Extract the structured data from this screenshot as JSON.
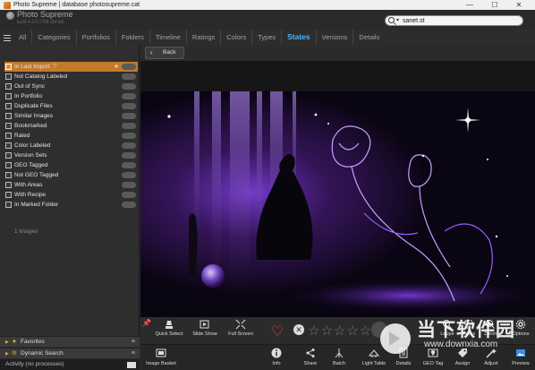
{
  "window": {
    "title": "Photo Supreme | database photosupreme.cat",
    "controls": {
      "minimize": "—",
      "maximize": "☐",
      "close": "✕"
    }
  },
  "header": {
    "app_name": "Photo Supreme",
    "version": "build 4.3.2.1758 (64-bit)",
    "search_value": "sanet.st",
    "search_caret": "▾"
  },
  "nav": {
    "tabs": [
      {
        "label": "All",
        "active": false
      },
      {
        "label": "Categories",
        "active": false
      },
      {
        "label": "Portfolios",
        "active": false
      },
      {
        "label": "Folders",
        "active": false
      },
      {
        "label": "Timeline",
        "active": false
      },
      {
        "label": "Ratings",
        "active": false
      },
      {
        "label": "Colors",
        "active": false
      },
      {
        "label": "Types",
        "active": false
      },
      {
        "label": "States",
        "active": true
      },
      {
        "label": "Versions",
        "active": false
      },
      {
        "label": "Details",
        "active": false
      }
    ]
  },
  "sidebar": {
    "states": [
      {
        "label": "In Last Import",
        "selected": true
      },
      {
        "label": "Not Catalog Labeled"
      },
      {
        "label": "Out of Sync"
      },
      {
        "label": "In Portfolio"
      },
      {
        "label": "Duplicate Files"
      },
      {
        "label": "Similar Images"
      },
      {
        "label": "Bookmarked"
      },
      {
        "label": "Rated"
      },
      {
        "label": "Color Labeled"
      },
      {
        "label": "Version Sets"
      },
      {
        "label": "GEO Tagged"
      },
      {
        "label": "Not GEO Tagged"
      },
      {
        "label": "With Areas"
      },
      {
        "label": "With Recipe"
      },
      {
        "label": "In Marked Folder"
      }
    ],
    "image_count": "1 images",
    "favorites_label": "Favorites",
    "dynamic_search_label": "Dynamic Search",
    "activity_label": "Activity (no processes)"
  },
  "main": {
    "back_label": "Back",
    "toolbar_top": [
      {
        "label": "Quick Select",
        "icon": "quick-select-icon"
      },
      {
        "label": "Slide Show",
        "icon": "slide-show-icon"
      },
      {
        "label": "Full Screen",
        "icon": "full-screen-icon"
      }
    ],
    "toolbar_top_right": [
      {
        "label": "Loupe",
        "icon": "loupe-icon"
      },
      {
        "label": "Areas",
        "icon": "areas-icon"
      },
      {
        "label": "Zoom",
        "icon": "zoom-icon"
      },
      {
        "label": "Options",
        "icon": "options-icon"
      }
    ],
    "toolbar_bottom": [
      {
        "label": "Image Basket",
        "icon": "image-basket-icon"
      },
      {
        "label": "Info",
        "icon": "info-icon"
      },
      {
        "label": "Share",
        "icon": "share-icon"
      },
      {
        "label": "Batch",
        "icon": "batch-icon"
      },
      {
        "label": "Light Table",
        "icon": "light-table-icon"
      },
      {
        "label": "Details",
        "icon": "details-icon"
      },
      {
        "label": "GEO Tag",
        "icon": "geo-tag-icon"
      },
      {
        "label": "Assign",
        "icon": "assign-icon"
      },
      {
        "label": "Adjust",
        "icon": "adjust-icon"
      },
      {
        "label": "Preview",
        "icon": "preview-icon"
      }
    ]
  },
  "watermark": {
    "text": "当下软件园",
    "url": "www.downxia.com"
  },
  "colors": {
    "accent": "#4fb4ff",
    "selected_row": "#c47a2b",
    "photo_glow": "#8a3cff"
  }
}
